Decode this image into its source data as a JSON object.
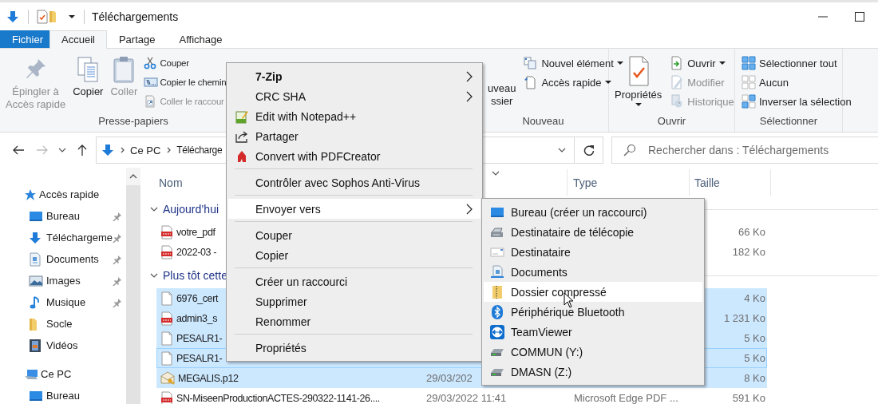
{
  "title_bar": {
    "title": "Téléchargements"
  },
  "ribbon_tabs": [
    {
      "label": "Fichier",
      "kind": "file",
      "selected": false
    },
    {
      "label": "Accueil",
      "kind": "tab",
      "selected": true
    },
    {
      "label": "Partage",
      "kind": "tab",
      "selected": false
    },
    {
      "label": "Affichage",
      "kind": "tab",
      "selected": false
    }
  ],
  "ribbon_groups": [
    {
      "label": "Presse-papiers",
      "commands": [
        {
          "label": "Épingler à\nAccès rapide",
          "kind": "large",
          "disabled": true,
          "dropdown": false
        },
        {
          "label": "Copier",
          "kind": "large",
          "disabled": false,
          "dropdown": false
        },
        {
          "label": "Coller",
          "kind": "large",
          "disabled": true,
          "dropdown": false
        },
        {
          "label": "Couper",
          "kind": "small",
          "disabled": false,
          "dropdown": false
        },
        {
          "label": "Copier le chemin",
          "kind": "small",
          "disabled": false,
          "dropdown": false
        },
        {
          "label": "Coller le raccour",
          "kind": "small",
          "disabled": true,
          "dropdown": false
        }
      ]
    },
    {
      "label": "Nouveau",
      "commands": [
        {
          "label": "uveau\nssier",
          "kind": "large",
          "disabled": false,
          "dropdown": false
        },
        {
          "label": "Nouvel élément",
          "kind": "small",
          "disabled": false,
          "dropdown": true
        },
        {
          "label": "Accès rapide",
          "kind": "small",
          "disabled": false,
          "dropdown": true
        }
      ]
    },
    {
      "label": "Ouvrir",
      "commands": [
        {
          "label": "Propriétés",
          "kind": "large",
          "disabled": false,
          "dropdown": true
        },
        {
          "label": "Ouvrir",
          "kind": "small",
          "disabled": false,
          "dropdown": true
        },
        {
          "label": "Modifier",
          "kind": "small",
          "disabled": true,
          "dropdown": false
        },
        {
          "label": "Historique",
          "kind": "small",
          "disabled": true,
          "dropdown": false
        }
      ]
    },
    {
      "label": "Sélectionner",
      "commands": [
        {
          "label": "Sélectionner tout",
          "kind": "small",
          "disabled": false,
          "dropdown": false
        },
        {
          "label": "Aucun",
          "kind": "small",
          "disabled": false,
          "dropdown": false
        },
        {
          "label": "Inverser la sélection",
          "kind": "small",
          "disabled": false,
          "dropdown": false
        }
      ]
    }
  ],
  "address_bar": {
    "path": [
      {
        "label": "Ce PC"
      },
      {
        "label": "Télécharge"
      }
    ]
  },
  "search": {
    "placeholder": "Rechercher dans : Téléchargements"
  },
  "navigation": {
    "items": [
      {
        "label": "Accès rapide",
        "children": [
          {
            "label": "Bureau",
            "pinned": true
          },
          {
            "label": "Téléchargeme",
            "pinned": true
          },
          {
            "label": "Documents",
            "pinned": true
          },
          {
            "label": "Images",
            "pinned": true
          },
          {
            "label": "Musique",
            "pinned": true
          },
          {
            "label": "Socle",
            "pinned": false
          },
          {
            "label": "Vidéos",
            "pinned": false
          }
        ]
      },
      {
        "label": "Ce PC",
        "children": [
          {
            "label": "Bureau",
            "pinned": false
          }
        ]
      }
    ]
  },
  "file_list": {
    "columns": [
      {
        "label": "Nom"
      },
      {
        "label": "Type"
      },
      {
        "label": "Taille"
      }
    ],
    "groups": [
      {
        "label": "Aujourd’hui",
        "expanded": true,
        "rows": [
          {
            "name": "votre_pdf",
            "size": "66 Ko",
            "kind": "pdf",
            "selected": false,
            "focused": false
          },
          {
            "name": "2022-03 -",
            "size": "182 Ko",
            "kind": "pdf",
            "selected": false,
            "focused": false
          }
        ]
      },
      {
        "label": "Plus tôt cette",
        "expanded": true,
        "rows": [
          {
            "name": "6976_cert",
            "size": "4 Ko",
            "kind": "blank",
            "selected": true,
            "focused": false
          },
          {
            "name": "admin3_s",
            "size": "1 231 Ko",
            "kind": "pdf",
            "selected": true,
            "focused": false
          },
          {
            "name": "PESALR1-",
            "size": "5 Ko",
            "kind": "blank",
            "selected": true,
            "focused": false
          },
          {
            "name": "PESALR1-",
            "size": "5 Ko",
            "kind": "blank",
            "selected": true,
            "focused": true
          },
          {
            "name": "MEGALIS.p12",
            "date": "29/03/202",
            "size": "8 Ko",
            "kind": "certificate",
            "selected": true,
            "focused": false
          },
          {
            "name": "SN-MiseenProductionACTES-290322-1141-26....",
            "date": "29/03/2022 11:41",
            "type": "Microsoft Edge PDF ...",
            "size": "591 Ko",
            "kind": "pdf",
            "selected": false,
            "focused": false
          }
        ]
      }
    ]
  },
  "context_menu": {
    "items": [
      {
        "label": "7-Zip",
        "kind": "submenu",
        "bold": true,
        "highlighted": false,
        "separator_before": false
      },
      {
        "label": "CRC SHA",
        "kind": "submenu",
        "bold": false,
        "highlighted": false,
        "separator_before": false
      },
      {
        "label": "Edit with Notepad++",
        "kind": "item",
        "bold": false,
        "highlighted": false,
        "separator_before": false
      },
      {
        "label": "Partager",
        "kind": "item",
        "bold": false,
        "highlighted": false,
        "separator_before": false
      },
      {
        "label": "Convert with PDFCreator",
        "kind": "item",
        "bold": false,
        "highlighted": false,
        "separator_before": false
      },
      {
        "label": "Contrôler avec Sophos Anti-Virus",
        "kind": "item",
        "bold": false,
        "highlighted": false,
        "separator_before": true
      },
      {
        "label": "Envoyer vers",
        "kind": "submenu",
        "bold": false,
        "highlighted": true,
        "separator_before": true
      },
      {
        "label": "Couper",
        "kind": "item",
        "bold": false,
        "highlighted": false,
        "separator_before": true
      },
      {
        "label": "Copier",
        "kind": "item",
        "bold": false,
        "highlighted": false,
        "separator_before": false
      },
      {
        "label": "Créer un raccourci",
        "kind": "item",
        "bold": false,
        "highlighted": false,
        "separator_before": true
      },
      {
        "label": "Supprimer",
        "kind": "item",
        "bold": false,
        "highlighted": false,
        "separator_before": false
      },
      {
        "label": "Renommer",
        "kind": "item",
        "bold": false,
        "highlighted": false,
        "separator_before": false
      },
      {
        "label": "Propriétés",
        "kind": "item",
        "bold": false,
        "highlighted": false,
        "separator_before": true
      }
    ]
  },
  "send_to_menu": {
    "items": [
      {
        "label": "Bureau (créer un raccourci)",
        "highlighted": false
      },
      {
        "label": "Destinataire de télécopie",
        "highlighted": false
      },
      {
        "label": "Destinataire",
        "highlighted": false
      },
      {
        "label": "Documents",
        "highlighted": false
      },
      {
        "label": "Dossier compressé",
        "highlighted": true
      },
      {
        "label": "Périphérique Bluetooth",
        "highlighted": false
      },
      {
        "label": "TeamViewer",
        "highlighted": false
      },
      {
        "label": "COMMUN (Y:)",
        "highlighted": false
      },
      {
        "label": "DMASN (Z:)",
        "highlighted": false
      }
    ]
  }
}
